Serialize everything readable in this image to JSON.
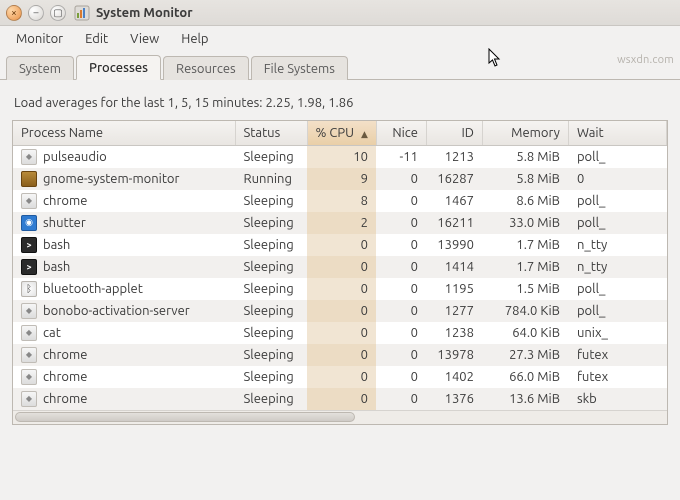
{
  "window": {
    "title": "System Monitor"
  },
  "menubar": {
    "items": [
      "Monitor",
      "Edit",
      "View",
      "Help"
    ]
  },
  "tabs": {
    "items": [
      "System",
      "Processes",
      "Resources",
      "File Systems"
    ],
    "active_index": 1
  },
  "load_avg": {
    "label": "Load averages for the last 1, 5, 15 minutes:",
    "values": "2.25, 1.98, 1.86"
  },
  "columns": {
    "process": "Process Name",
    "status": "Status",
    "cpu": "% CPU",
    "nice": "Nice",
    "id": "ID",
    "memory": "Memory",
    "wait": "Wait"
  },
  "sort": {
    "column": "cpu",
    "direction": "asc"
  },
  "processes": [
    {
      "icon": "generic",
      "name": "pulseaudio",
      "status": "Sleeping",
      "cpu": 10,
      "nice": -11,
      "id": 1213,
      "memory": "5.8 MiB",
      "wait": "poll_"
    },
    {
      "icon": "gnome",
      "name": "gnome-system-monitor",
      "status": "Running",
      "cpu": 9,
      "nice": 0,
      "id": 16287,
      "memory": "5.8 MiB",
      "wait": "0"
    },
    {
      "icon": "generic",
      "name": "chrome",
      "status": "Sleeping",
      "cpu": 8,
      "nice": 0,
      "id": 1467,
      "memory": "8.6 MiB",
      "wait": "poll_"
    },
    {
      "icon": "shutter",
      "name": "shutter",
      "status": "Sleeping",
      "cpu": 2,
      "nice": 0,
      "id": 16211,
      "memory": "33.0 MiB",
      "wait": "poll_"
    },
    {
      "icon": "term",
      "name": "bash",
      "status": "Sleeping",
      "cpu": 0,
      "nice": 0,
      "id": 13990,
      "memory": "1.7 MiB",
      "wait": "n_tty"
    },
    {
      "icon": "term",
      "name": "bash",
      "status": "Sleeping",
      "cpu": 0,
      "nice": 0,
      "id": 1414,
      "memory": "1.7 MiB",
      "wait": "n_tty"
    },
    {
      "icon": "bt",
      "name": "bluetooth-applet",
      "status": "Sleeping",
      "cpu": 0,
      "nice": 0,
      "id": 1195,
      "memory": "1.5 MiB",
      "wait": "poll_"
    },
    {
      "icon": "generic",
      "name": "bonobo-activation-server",
      "status": "Sleeping",
      "cpu": 0,
      "nice": 0,
      "id": 1277,
      "memory": "784.0 KiB",
      "wait": "poll_"
    },
    {
      "icon": "generic",
      "name": "cat",
      "status": "Sleeping",
      "cpu": 0,
      "nice": 0,
      "id": 1238,
      "memory": "64.0 KiB",
      "wait": "unix_"
    },
    {
      "icon": "generic",
      "name": "chrome",
      "status": "Sleeping",
      "cpu": 0,
      "nice": 0,
      "id": 13978,
      "memory": "27.3 MiB",
      "wait": "futex"
    },
    {
      "icon": "generic",
      "name": "chrome",
      "status": "Sleeping",
      "cpu": 0,
      "nice": 0,
      "id": 1402,
      "memory": "66.0 MiB",
      "wait": "futex"
    },
    {
      "icon": "generic",
      "name": "chrome",
      "status": "Sleeping",
      "cpu": 0,
      "nice": 0,
      "id": 1376,
      "memory": "13.6 MiB",
      "wait": "skb"
    }
  ],
  "watermark": "wsxdn.com"
}
